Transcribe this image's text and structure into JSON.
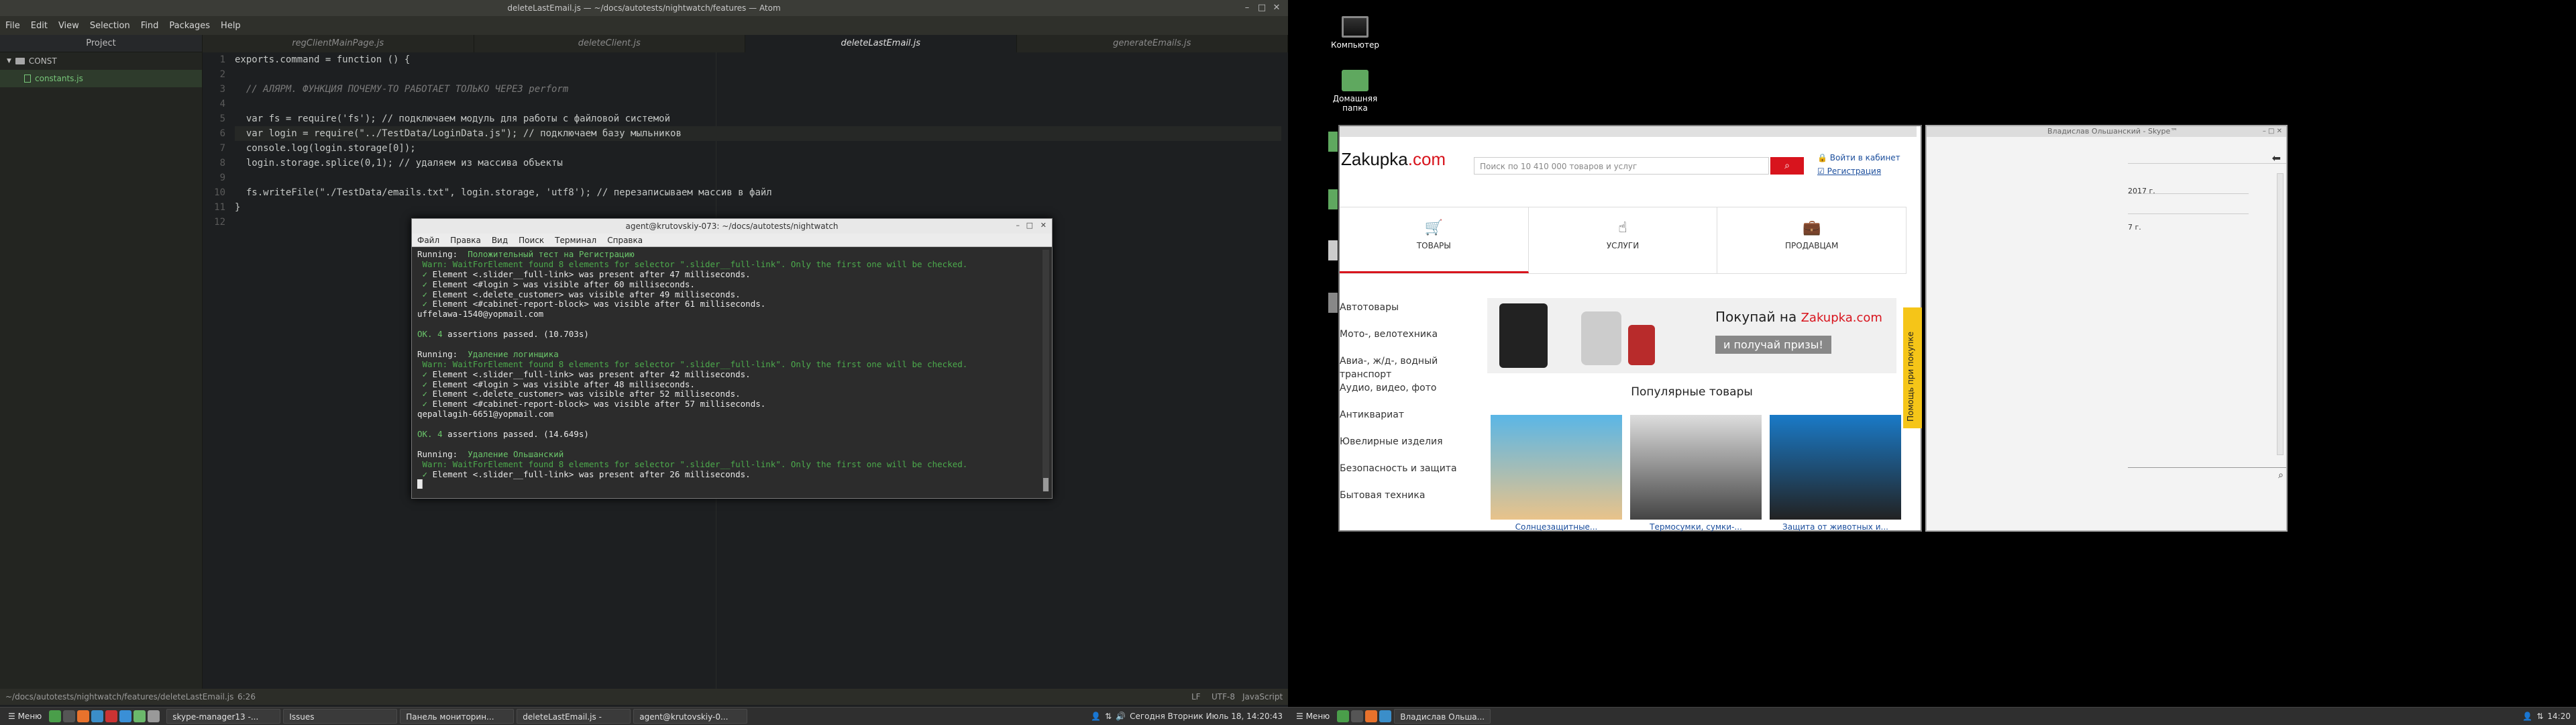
{
  "atom": {
    "title": "deleteLastEmail.js — ~/docs/autotests/nightwatch/features — Atom",
    "menu": [
      "File",
      "Edit",
      "View",
      "Selection",
      "Find",
      "Packages",
      "Help"
    ],
    "project_label": "Project",
    "tree_root": "CONST",
    "tree_file": "constants.js",
    "tabs": [
      "regClientMainPage.js",
      "deleteClient.js",
      "deleteLastEmail.js",
      "generateEmails.js"
    ],
    "active_tab": 2,
    "line_numbers": [
      "1",
      "2",
      "3",
      "4",
      "5",
      "6",
      "7",
      "8",
      "9",
      "10",
      "11",
      "12"
    ],
    "code_lines": [
      "exports.command = function () {",
      "",
      "  // АЛЯРМ. ФУНКЦИЯ ПОЧЕМУ-ТО РАБОТАЕТ ТОЛЬКО ЧЕРЕЗ perform",
      "",
      "  var fs = require('fs'); // подключаем модуль для работы с файловой системой",
      "  var login = require(\"../TestData/LoginData.js\"); // подключаем базу мыльников",
      "  console.log(login.storage[0]);",
      "  login.storage.splice(0,1); // удаляем из массива объекты",
      "",
      "  fs.writeFile(\"./TestData/emails.txt\", login.storage, 'utf8'); // перезаписываем массив в файл",
      "}",
      ""
    ],
    "status_path": "~/docs/autotests/nightwatch/features/deleteLastEmail.js",
    "status_pos": "6:26",
    "status_right": [
      "LF",
      "UTF-8",
      "JavaScript"
    ]
  },
  "terminal": {
    "title": "agent@krutovskiy-073: ~/docs/autotests/nightwatch",
    "menu": [
      "Файл",
      "Правка",
      "Вид",
      "Поиск",
      "Терминал",
      "Справка"
    ],
    "lines": [
      {
        "t": "Running:  Положительный тест на Регистрацию",
        "c": "run"
      },
      {
        "t": " Warn: WaitForElement found 8 elements for selector \".slider__full-link\". Only the first one will be checked.",
        "c": "warn"
      },
      {
        "t": " ✓ Element <.slider__full-link> was present after 47 milliseconds.",
        "c": "ok"
      },
      {
        "t": " ✓ Element <#login > was visible after 60 milliseconds.",
        "c": "ok"
      },
      {
        "t": " ✓ Element <.delete_customer> was visible after 49 milliseconds.",
        "c": "ok"
      },
      {
        "t": " ✓ Element <#cabinet-report-block> was visible after 61 milliseconds.",
        "c": "ok"
      },
      {
        "t": "uffelawa-1540@yopmail.com",
        "c": "plain"
      },
      {
        "t": "",
        "c": "plain"
      },
      {
        "t": "OK. 4 assertions passed. (10.703s)",
        "c": "pass"
      },
      {
        "t": "",
        "c": "plain"
      },
      {
        "t": "Running:  Удаление логинщика",
        "c": "run"
      },
      {
        "t": " Warn: WaitForElement found 8 elements for selector \".slider__full-link\". Only the first one will be checked.",
        "c": "warn"
      },
      {
        "t": " ✓ Element <.slider__full-link> was present after 42 milliseconds.",
        "c": "ok"
      },
      {
        "t": " ✓ Element <#login > was visible after 48 milliseconds.",
        "c": "ok"
      },
      {
        "t": " ✓ Element <.delete_customer> was visible after 52 milliseconds.",
        "c": "ok"
      },
      {
        "t": " ✓ Element <#cabinet-report-block> was visible after 57 milliseconds.",
        "c": "ok"
      },
      {
        "t": "qepallagih-6651@yopmail.com",
        "c": "plain"
      },
      {
        "t": "",
        "c": "plain"
      },
      {
        "t": "OK. 4 assertions passed. (14.649s)",
        "c": "pass"
      },
      {
        "t": "",
        "c": "plain"
      },
      {
        "t": "Running:  Удаление Ольшанский",
        "c": "run"
      },
      {
        "t": " Warn: WaitForElement found 8 elements for selector \".slider__full-link\". Only the first one will be checked.",
        "c": "warn"
      },
      {
        "t": " ✓ Element <.slider__full-link> was present after 26 milliseconds.",
        "c": "ok"
      },
      {
        "t": "█",
        "c": "plain"
      }
    ]
  },
  "left_taskbar": {
    "menu_label": "Меню",
    "windows": [
      "skype-manager13 -...",
      "Issues",
      "Панель мониторин...",
      "deleteLastEmail.js -",
      "agent@krutovskiy-0..."
    ],
    "clock": "Сегодня Вторник Июль 18, 14:20:43"
  },
  "desktop": {
    "icons": [
      "Компьютер",
      "Домашняя папка"
    ]
  },
  "browser": {
    "logo_prefix": "Zakupka",
    "logo_suffix": ".com",
    "search_placeholder": "Поиск по 10 410 000 товаров и услуг",
    "login_link": "Войти в кабинет",
    "register_link": "Регистрация",
    "tabs": [
      "ТОВАРЫ",
      "УСЛУГИ",
      "ПРОДАВЦАМ"
    ],
    "categories": [
      "Автотовары",
      "Мото-, велотехника",
      "Авиа-, ж/д-, водный транспорт",
      "Аудио, видео, фото",
      "Антиквариат",
      "Ювелирные изделия",
      "Безопасность и защита",
      "Бытовая техника"
    ],
    "banner_text": "Покупай на",
    "banner_brand": "Zakupka.com",
    "banner_cta": "и получай призы!",
    "popular_title": "Популярные товары",
    "products": [
      "Солнцезащитные...",
      "Термосумки, сумки-...",
      "Защита от животных и..."
    ],
    "help_tab": "Помощь при покупке"
  },
  "skype": {
    "title": "Владислав Ольшанский - Skype™",
    "items": [
      "2017 г.",
      "7 г."
    ]
  },
  "right_taskbar": {
    "menu_label": "Меню",
    "window": "Владислав Ольша...",
    "clock": "14:20"
  }
}
